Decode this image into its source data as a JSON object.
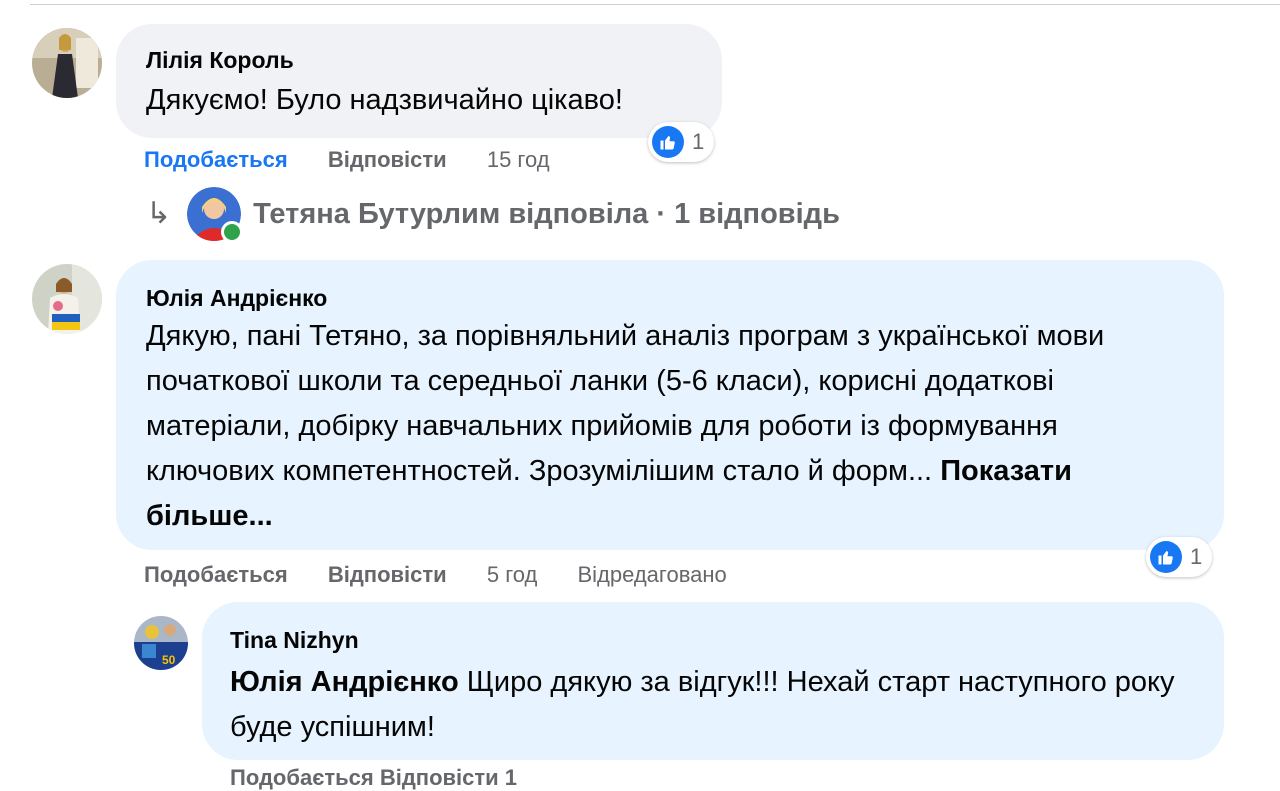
{
  "comments": [
    {
      "author": "Лілія Король",
      "text": "Дякуємо! Було надзвичайно цікаво!",
      "reactions": "1",
      "like": "Подобається",
      "reply": "Відповісти",
      "time": "15 год",
      "replies": {
        "arrow": "↳",
        "summary": "Тетяна Бутурлим відповіла · 1 відповідь"
      }
    },
    {
      "author": "Юлія Андрієнко",
      "text": "Дякую, пані Тетяно, за порівняльний аналіз програм з української мови початкової школи та середньої ланки (5-6 класи), корисні додаткові матеріали, добірку навчальних прийомів для роботи із формування ключових компетентностей. Зрозумілішим стало й форм...",
      "more": "Показати більше...",
      "reactions": "1",
      "like": "Подобається",
      "reply": "Відповісти",
      "time": "5 год",
      "edited": "Відредаговано"
    }
  ],
  "reply": {
    "author": "Tina Nizhyn",
    "mention": "Юлія Андрієнко",
    "text": "Щиро дякую за відгук!!! Нехай старт наступного року буде успішним!",
    "avatar_badge": "50",
    "actions_cutoff": "Подобається  Відповісти  1"
  },
  "colors": {
    "like_blue": "#1877f2",
    "meta_grey": "#65676b",
    "bubble_grey": "#f0f2f5",
    "bubble_blue": "#e7f3ff",
    "online_green": "#31a24c"
  }
}
